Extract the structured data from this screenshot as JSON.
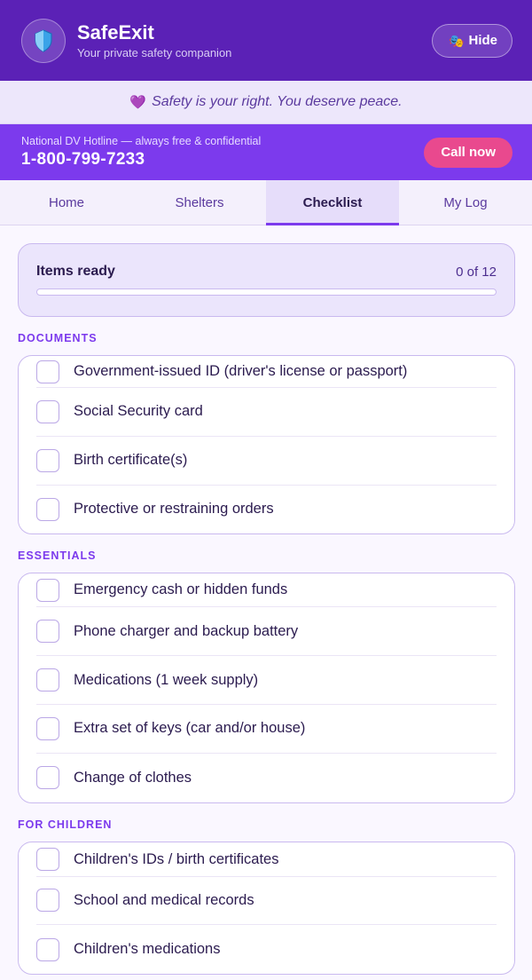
{
  "header": {
    "title": "SafeExit",
    "subtitle": "Your private safety companion",
    "hide_label": "Hide",
    "logo_icon": "shield-icon",
    "hide_icon": "mask-icon"
  },
  "affirmation": {
    "icon": "heart-icon",
    "text": "Safety is your right. You deserve peace."
  },
  "hotline": {
    "caption": "National DV Hotline — always free & confidential",
    "number": "1-800-799-7233",
    "call_label": "Call now"
  },
  "tabs": [
    {
      "label": "Home",
      "active": false
    },
    {
      "label": "Shelters",
      "active": false
    },
    {
      "label": "Checklist",
      "active": true
    },
    {
      "label": "My Log",
      "active": false
    }
  ],
  "progress": {
    "label": "Items ready",
    "count_text": "0 of 12",
    "fraction": 0
  },
  "sections": [
    {
      "title": "DOCUMENTS",
      "items": [
        "Government-issued ID (driver's license or passport)",
        "Social Security card",
        "Birth certificate(s)",
        "Protective or restraining orders"
      ]
    },
    {
      "title": "ESSENTIALS",
      "items": [
        "Emergency cash or hidden funds",
        "Phone charger and backup battery",
        "Medications (1 week supply)",
        "Extra set of keys (car and/or house)",
        "Change of clothes"
      ]
    },
    {
      "title": "FOR CHILDREN",
      "items": [
        "Children's IDs / birth certificates",
        "School and medical records",
        "Children's medications"
      ]
    }
  ],
  "colors": {
    "header_bg": "#5b21b6",
    "hotline_bg": "#7c3aed",
    "call_button": "#e9498e",
    "accent": "#7c3aed"
  }
}
